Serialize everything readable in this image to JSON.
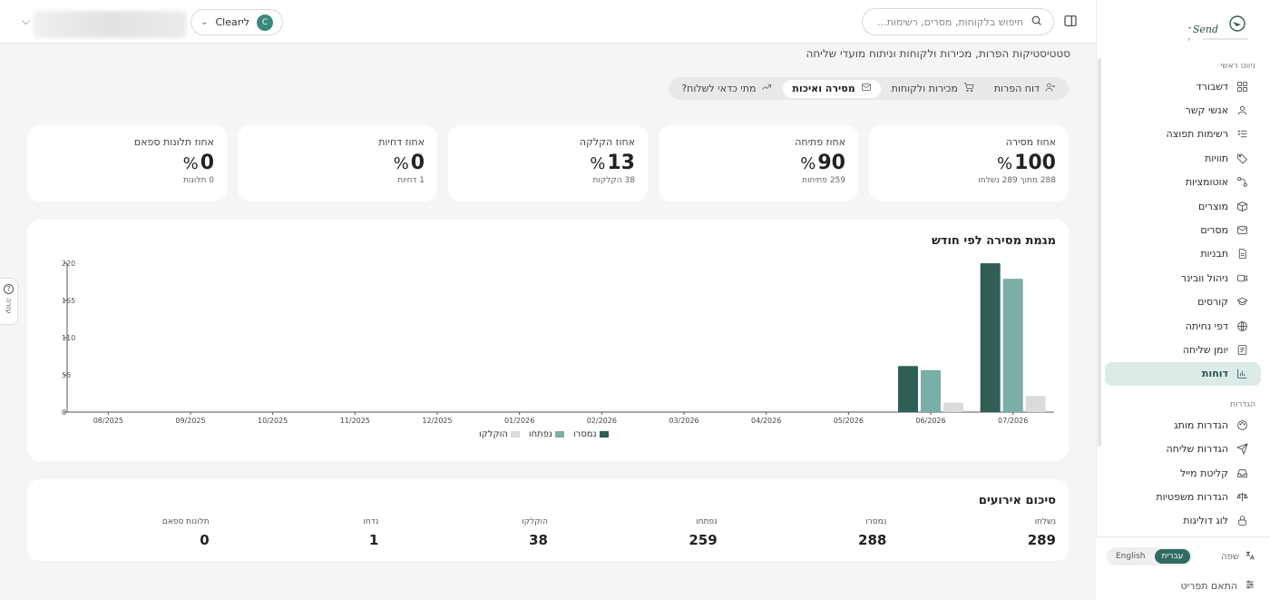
{
  "header": {
    "search_placeholder": "חיפוש בלקוחות, מסרים, רשימות...",
    "user_name": "ליClear",
    "user_initial": "C"
  },
  "brand": {
    "name": "ClearSend",
    "tagline": "Clear"
  },
  "sidebar": {
    "section_main": "ניווט ראשי",
    "items_main": [
      {
        "label": "דשבורד",
        "icon": "dashboard-icon"
      },
      {
        "label": "אנשי קשר",
        "icon": "contacts-icon"
      },
      {
        "label": "רשימות תפוצה",
        "icon": "list-icon"
      },
      {
        "label": "תוויות",
        "icon": "tag-icon"
      },
      {
        "label": "אוטומציות",
        "icon": "automation-icon"
      },
      {
        "label": "מוצרים",
        "icon": "box-icon"
      },
      {
        "label": "מסרים",
        "icon": "mail-icon"
      },
      {
        "label": "תבניות",
        "icon": "template-icon"
      },
      {
        "label": "ניהול וובינר",
        "icon": "video-icon"
      },
      {
        "label": "קורסים",
        "icon": "graduation-icon"
      },
      {
        "label": "דפי נחיתה",
        "icon": "globe-icon"
      },
      {
        "label": "יומן שליחה",
        "icon": "log-icon"
      },
      {
        "label": "דוחות",
        "icon": "chart-icon",
        "active": true
      }
    ],
    "section_settings": "הגדרות",
    "items_settings": [
      {
        "label": "הגדרות מותג",
        "icon": "palette-icon"
      },
      {
        "label": "הגדרות שליחה",
        "icon": "send-icon"
      },
      {
        "label": "קליטת מייל",
        "icon": "inbox-icon"
      },
      {
        "label": "הגדרות משפטיות",
        "icon": "scale-icon"
      },
      {
        "label": "לוג דוליגות",
        "icon": "lock-icon"
      }
    ],
    "language_label": "שפה",
    "lang_he": "עברית",
    "lang_en": "English",
    "customize_label": "התאם תפריט"
  },
  "page": {
    "subtitle": "סטטיסטיקות הפרות, מכירות ולקוחות וניתוח מועדי שליחה",
    "tabs": [
      {
        "label": "דוח הפרות",
        "icon": "user-x-icon"
      },
      {
        "label": "מכירות ולקוחות",
        "icon": "cart-icon"
      },
      {
        "label": "מסירה ואיכות",
        "icon": "envelope-icon",
        "active": true
      },
      {
        "label": "מתי כדאי לשלוח?",
        "icon": "trend-icon"
      }
    ]
  },
  "kpis": [
    {
      "label": "אחוז מסירה",
      "value": "100",
      "pct": "%",
      "sub": "288 מתוך 289 נשלחו"
    },
    {
      "label": "אחוז פתיחה",
      "value": "90",
      "pct": "%",
      "sub": "259 פתיחות"
    },
    {
      "label": "אחוז הקלקה",
      "value": "13",
      "pct": "%",
      "sub": "38 הקלקות"
    },
    {
      "label": "אחוז דחיות",
      "value": "0",
      "pct": "%",
      "sub": "1 דחיות"
    },
    {
      "label": "אחוז תלונות ספאם",
      "value": "0",
      "pct": "%",
      "sub": "0 תלונות"
    }
  ],
  "chart_title": "מגמת מסירה לפי חודש",
  "chart_data": {
    "type": "bar",
    "categories": [
      "08/2025",
      "09/2025",
      "10/2025",
      "11/2025",
      "12/2025",
      "01/2026",
      "02/2026",
      "03/2026",
      "04/2026",
      "05/2026",
      "06/2026",
      "07/2026"
    ],
    "series": [
      {
        "name": "נמסרו",
        "color": "#2f5e55",
        "values": [
          0,
          0,
          0,
          0,
          0,
          0,
          0,
          0,
          0,
          0,
          68,
          220
        ]
      },
      {
        "name": "נפתחו",
        "color": "#7aaea6",
        "values": [
          0,
          0,
          0,
          0,
          0,
          0,
          0,
          0,
          0,
          0,
          62,
          197
        ]
      },
      {
        "name": "הוקלקו",
        "color": "#d9dcdb",
        "values": [
          0,
          0,
          0,
          0,
          0,
          0,
          0,
          0,
          0,
          0,
          14,
          24
        ]
      }
    ],
    "yticks": [
      0,
      55,
      110,
      165,
      220
    ],
    "ylim": [
      0,
      220
    ],
    "legend": "bottom-center"
  },
  "summary": {
    "title": "סיכום אירועים",
    "items": [
      {
        "label": "נשלחו",
        "value": "289"
      },
      {
        "label": "נמסרו",
        "value": "288"
      },
      {
        "label": "נפתחו",
        "value": "259"
      },
      {
        "label": "הוקלקו",
        "value": "38"
      },
      {
        "label": "נדחו",
        "value": "1"
      },
      {
        "label": "תלונות ספאם",
        "value": "0"
      }
    ]
  },
  "help_label": "עזרה"
}
